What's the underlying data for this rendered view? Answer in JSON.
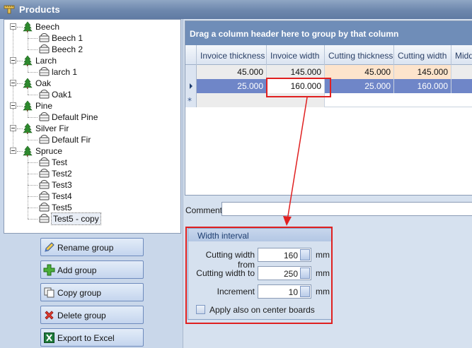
{
  "window": {
    "title": "Products"
  },
  "tree": {
    "groups": [
      {
        "name": "Beech",
        "items": [
          "Beech 1",
          "Beech 2"
        ]
      },
      {
        "name": "Larch",
        "items": [
          "larch 1"
        ]
      },
      {
        "name": "Oak",
        "items": [
          "Oak1"
        ]
      },
      {
        "name": "Pine",
        "items": [
          "Default Pine"
        ]
      },
      {
        "name": "Silver Fir",
        "items": [
          "Default Fir"
        ]
      },
      {
        "name": "Spruce",
        "items": [
          "Test",
          "Test2",
          "Test3",
          "Test4",
          "Test5",
          "Test5 - copy"
        ]
      }
    ]
  },
  "buttons": {
    "rename": "Rename group",
    "add": "Add group",
    "copy": "Copy group",
    "delete": "Delete group",
    "export": "Export to Excel"
  },
  "grid": {
    "group_panel_text": "Drag a column header here to group by that column",
    "columns": [
      "Invoice thickness",
      "Invoice width",
      "Cutting thickness",
      "Cutting width",
      "Middle"
    ],
    "rows": [
      [
        "45.000",
        "145.000",
        "45.000",
        "145.000",
        ""
      ],
      [
        "25.000",
        "160.000",
        "25.000",
        "160.000",
        ""
      ]
    ]
  },
  "comment": {
    "label": "Comment",
    "value": ""
  },
  "width_interval": {
    "title": "Width interval",
    "from_label": "Cutting width from",
    "from_value": "160",
    "to_label": "Cutting width to",
    "to_value": "250",
    "increment_label": "Increment",
    "increment_value": "10",
    "unit": "mm",
    "apply_label": "Apply also on center boards"
  },
  "colors": {
    "accent": "#6f8db8",
    "selected_row": "#6f86c8",
    "highlight_cell": "#fde4cc",
    "annotation": "#e02020"
  }
}
